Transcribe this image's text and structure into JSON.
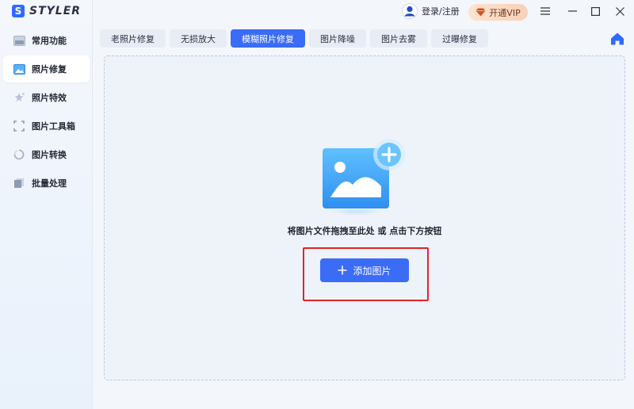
{
  "app": {
    "logo_text": "STYLER",
    "logo_letter": "S"
  },
  "sidebar": {
    "items": [
      {
        "label": "常用功能",
        "icon": "common-functions-icon"
      },
      {
        "label": "照片修复",
        "icon": "photo-repair-icon",
        "active": true
      },
      {
        "label": "照片特效",
        "icon": "photo-effects-icon"
      },
      {
        "label": "图片工具箱",
        "icon": "toolbox-icon"
      },
      {
        "label": "图片转换",
        "icon": "convert-icon"
      },
      {
        "label": "批量处理",
        "icon": "batch-icon"
      }
    ]
  },
  "topbar": {
    "login_label": "登录/注册",
    "vip_label": "开通VIP"
  },
  "tabs": [
    {
      "label": "老照片修复"
    },
    {
      "label": "无损放大"
    },
    {
      "label": "模糊照片修复",
      "active": true
    },
    {
      "label": "图片降噪"
    },
    {
      "label": "图片去雾"
    },
    {
      "label": "过曝修复"
    }
  ],
  "main": {
    "hint": "将图片文件拖拽至此处 或 点击下方按钮",
    "add_button_label": "添加图片"
  },
  "colors": {
    "accent": "#3b6cf6",
    "highlight": "#e0242a",
    "vip_bg": "#fde3cf"
  }
}
